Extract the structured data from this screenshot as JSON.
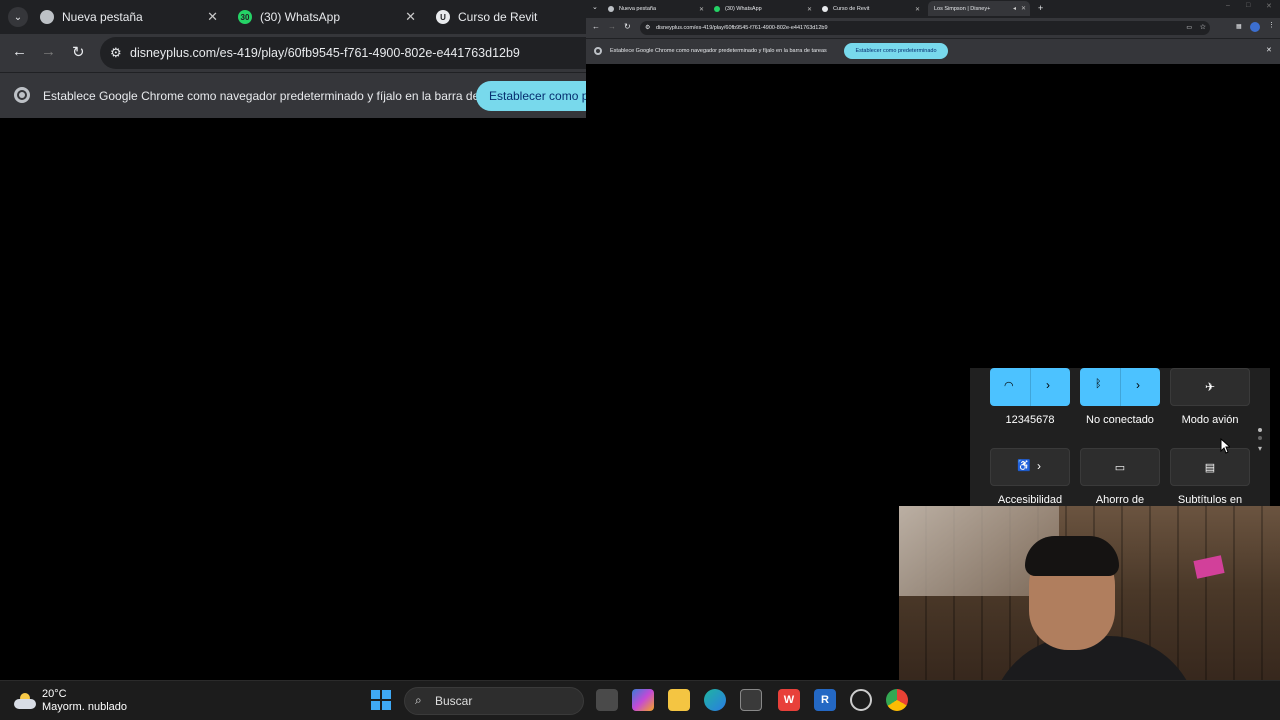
{
  "left_browser": {
    "tabs": [
      {
        "label": "Nueva pestaña",
        "icon": "chrome-icon"
      },
      {
        "label": "(30) WhatsApp",
        "icon": "whatsapp-icon",
        "badge": "30"
      },
      {
        "label": "Curso de Revit",
        "icon": "udemy-icon"
      }
    ],
    "url": "disneyplus.com/es-419/play/60fb9545-f761-4900-802e-e441763d12b9",
    "infobar_message": "Establece Google Chrome como navegador predeterminado y fíjalo en la barra de tareas",
    "infobar_button": "Establecer como pre"
  },
  "right_browser": {
    "tabs": [
      {
        "label": "Nueva pestaña"
      },
      {
        "label": "(30) WhatsApp"
      },
      {
        "label": "Curso de Revit"
      },
      {
        "label": "Los Simpson | Disney+"
      }
    ],
    "url": "disneyplus.com/es-419/play/60fb9545-f761-4900-802e-e441763d12b9",
    "infobar_message": "Establece Google Chrome como navegador predeterminado y fíjalo en la barra de tareas",
    "infobar_button": "Establecer como predeterminado"
  },
  "quick_settings": {
    "tiles": [
      {
        "label": "12345678",
        "icon": "wifi-icon",
        "active": true
      },
      {
        "label": "No conectado",
        "icon": "bluetooth-icon",
        "active": true
      },
      {
        "label": "Modo avión",
        "icon": "airplane-icon",
        "active": false
      },
      {
        "label": "Accesibilidad",
        "icon": "accessibility-icon",
        "active": false
      },
      {
        "label": "Ahorro de",
        "icon": "battery-saver-icon",
        "active": false
      },
      {
        "label": "Subtítulos en",
        "icon": "live-captions-icon",
        "active": false
      }
    ]
  },
  "taskbar": {
    "temperature": "20°C",
    "weather": "Mayorm. nublado",
    "search_placeholder": "Buscar"
  },
  "colors": {
    "accent": "#4cc2ff",
    "chrome_infobar_button": "#78d9ec",
    "tab_bg": "#202124",
    "toolbar_bg": "#35363a"
  }
}
